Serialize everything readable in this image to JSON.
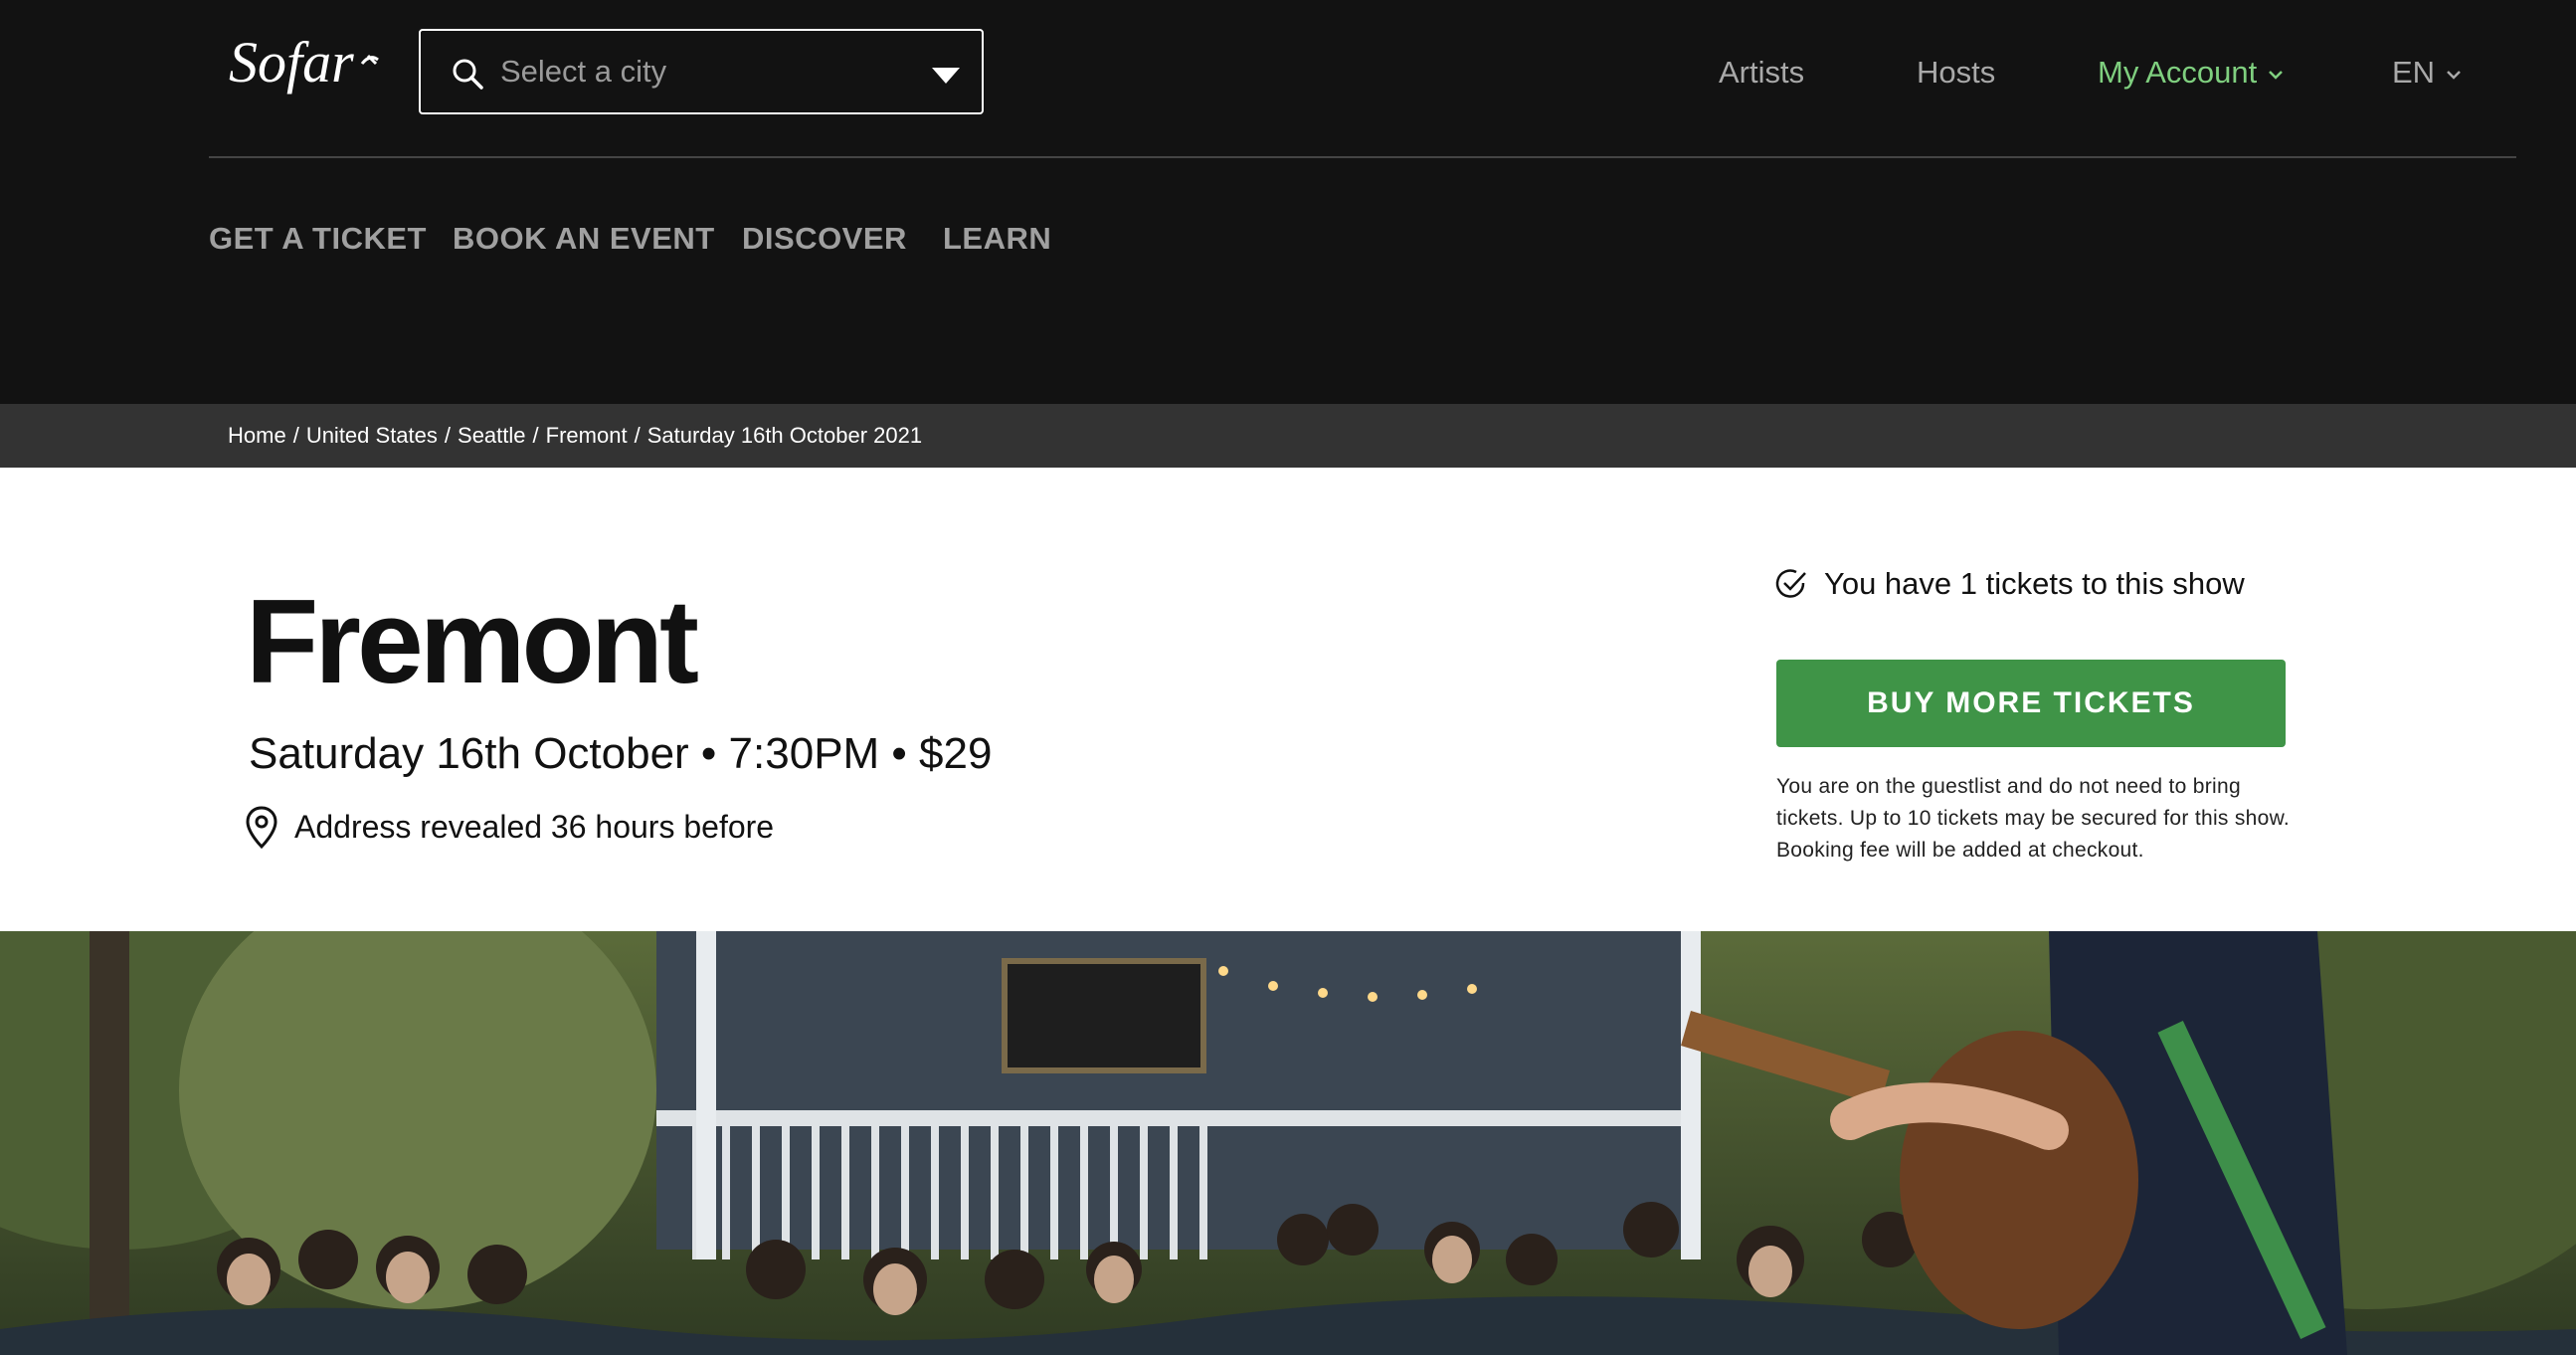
{
  "brand": {
    "logo_text": "Sofar"
  },
  "search": {
    "placeholder": "Select a city"
  },
  "top_nav": {
    "artists": "Artists",
    "hosts": "Hosts",
    "account": "My Account",
    "language": "EN"
  },
  "main_nav": [
    "GET A TICKET",
    "BOOK AN EVENT",
    "DISCOVER",
    "LEARN"
  ],
  "breadcrumb": [
    "Home",
    "United States",
    "Seattle",
    "Fremont",
    "Saturday 16th October 2021"
  ],
  "event": {
    "title": "Fremont",
    "meta": "Saturday 16th October • 7:30PM • $29",
    "address_note": "Address revealed 36 hours before"
  },
  "tickets": {
    "status": "You have 1 tickets to this show",
    "buy_button": "BUY MORE TICKETS",
    "note": "You are on the guestlist and do not need to bring tickets. Up to 10 tickets may be secured for this show. Booking fee will be added at checkout."
  },
  "colors": {
    "header_bg": "#121212",
    "breadcrumb_bg": "#333333",
    "accent_green": "#3f9447",
    "account_green": "#7fcf7f"
  },
  "icons": [
    "search-icon",
    "caret-down-icon",
    "chevron-down-icon",
    "check-circle-icon",
    "location-pin-icon"
  ]
}
